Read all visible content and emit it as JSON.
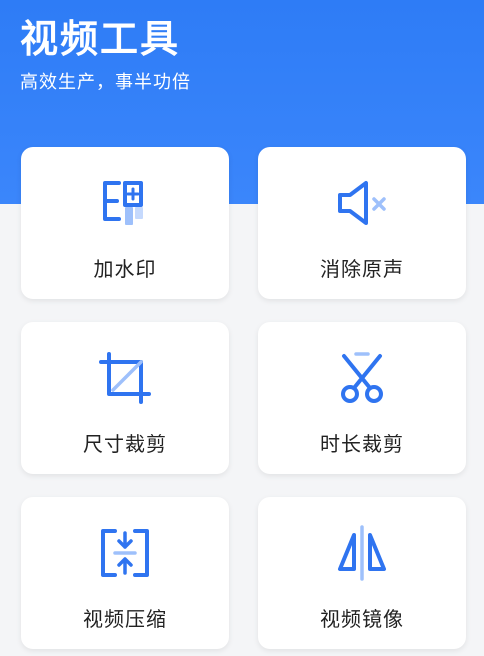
{
  "header": {
    "title": "视频工具",
    "subtitle": "高效生产，事半功倍"
  },
  "colors": {
    "accent": "#3b86fb",
    "icon": "#2f74f0",
    "icon_light": "#9ec0fb"
  },
  "tools": [
    {
      "label": "加水印",
      "icon": "watermark-icon"
    },
    {
      "label": "消除原声",
      "icon": "mute-icon"
    },
    {
      "label": "尺寸裁剪",
      "icon": "crop-icon"
    },
    {
      "label": "时长裁剪",
      "icon": "scissors-icon"
    },
    {
      "label": "视频压缩",
      "icon": "compress-icon"
    },
    {
      "label": "视频镜像",
      "icon": "mirror-icon"
    }
  ]
}
